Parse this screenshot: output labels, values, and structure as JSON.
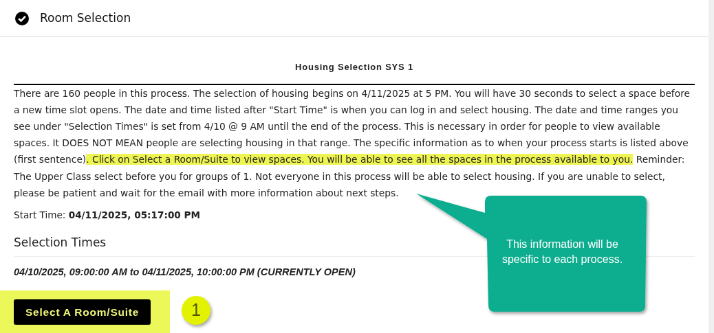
{
  "section": {
    "title": "Room Selection",
    "completed": true
  },
  "process_title": "Housing Selection SYS 1",
  "info": [
    {
      "text": "There are 160 people in this process. The selection of housing begins on 4/11/2025 at 5 PM. You will have 30 seconds to select a space before a new time slot opens. The date and time listed after \"Start Time\" is when you can log in and select housing. The date and time ranges you see under \"Selection Times\" is set from 4/10 @ 9 AM until the end of the process. This is necessary in order for people to view available spaces. It DOES NOT MEAN people are selecting housing in that range. The specific information as to when your process starts is listed above (first sentence)",
      "highlighted": false
    },
    {
      "text": ". Click on Select a Room/Suite to view spaces. You will be able to see all the spaces in the process available to you.",
      "highlighted": true
    },
    {
      "text": " Reminder: The Upper Class select before you for groups of 1. Not everyone in this process will be able to select housing. If you are unable to select, please be patient and wait for the email with more information about next steps.",
      "highlighted": false
    }
  ],
  "start_time": "Start Time: **04/11/2025, 05:17:00 PM**",
  "selection_times": {
    "heading": "Selection Times",
    "ranges": [
      "04/10/2025, 09:00:00 AM to 04/11/2025, 10:00:00 PM (CURRENTLY OPEN)"
    ]
  },
  "button": {
    "label": "Select A Room/Suite",
    "highlighted": true
  },
  "annotations": [
    {
      "kind": "callout",
      "text": "This information will be specific to each process."
    },
    {
      "kind": "step",
      "text": "1"
    }
  ]
}
